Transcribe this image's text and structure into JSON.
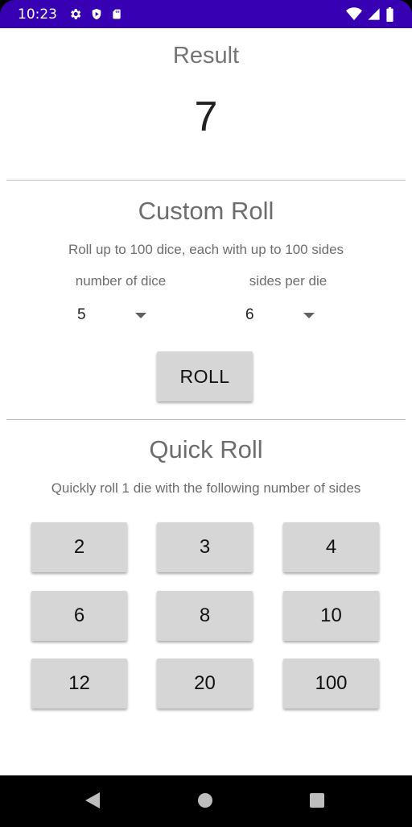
{
  "status_bar": {
    "time": "10:23",
    "left_icons": [
      "gear-icon",
      "shield-play-icon",
      "sd-card-icon"
    ],
    "right_icons": [
      "wifi-icon",
      "signal-icon",
      "battery-icon"
    ],
    "color": "#3700b3"
  },
  "result": {
    "title": "Result",
    "value": "7"
  },
  "custom_roll": {
    "title": "Custom Roll",
    "subtitle": "Roll up to 100 dice, each with up to 100 sides",
    "dice_label": "number of dice",
    "sides_label": "sides per die",
    "dice_value": "5",
    "sides_value": "6",
    "roll_label": "ROLL"
  },
  "quick_roll": {
    "title": "Quick Roll",
    "subtitle": "Quickly roll 1 die with the following number of sides",
    "buttons": [
      "2",
      "3",
      "4",
      "6",
      "8",
      "10",
      "12",
      "20",
      "100"
    ]
  },
  "nav_bar": {
    "icons": [
      "back-icon",
      "home-icon",
      "recents-icon"
    ]
  }
}
